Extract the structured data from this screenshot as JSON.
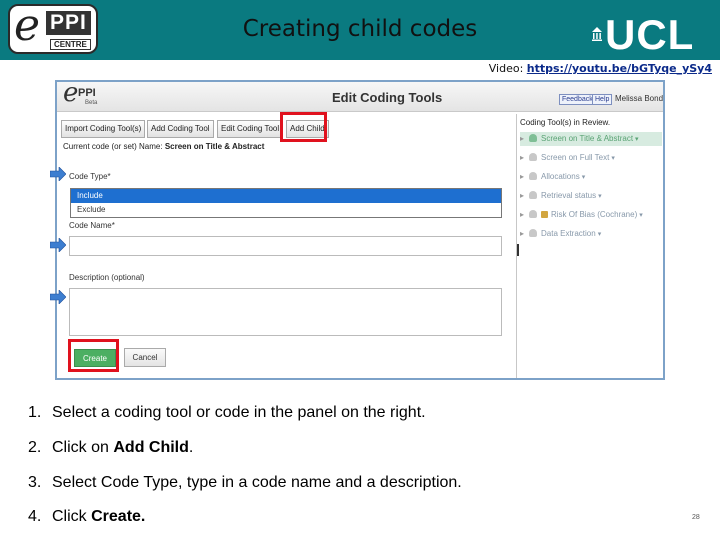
{
  "slide": {
    "title": "Creating child codes",
    "video_prefix": "Video: ",
    "video_link": "https://youtu.be/bGTyqe_ySy4",
    "page_number": "28"
  },
  "logos": {
    "eppi_letter": "e",
    "eppi_ppi": "PPI",
    "eppi_centre": "CENTRE",
    "ucl": "UCL"
  },
  "app": {
    "logo_letter": "e",
    "logo_text": "PPI",
    "logo_sub": "Beta",
    "title": "Edit Coding Tools",
    "feedback": "Feedback",
    "help": "Help",
    "user": "Melissa Bond",
    "tools": [
      "Import Coding Tool(s)",
      "Add Coding Tool",
      "Edit Coding Tool",
      "Add Child"
    ],
    "current_label": "Current code (or set) Name: ",
    "current_value": "Screen on Title & Abstract",
    "code_type_label": "Code Type*",
    "code_type_options": [
      "Include",
      "Exclude"
    ],
    "code_name_label": "Code Name*",
    "code_name_value": "",
    "description_label": "Description (optional)",
    "description_value": "",
    "create": "Create",
    "cancel": "Cancel",
    "tree_title": "Coding Tool(s) in Review.",
    "tree": [
      {
        "label": "Screen on Title & Abstract",
        "active": true
      },
      {
        "label": "Screen on Full Text",
        "active": false
      },
      {
        "label": "Allocations",
        "active": false
      },
      {
        "label": "Retrieval status",
        "active": false
      },
      {
        "label": "Risk Of Bias (Cochrane)",
        "active": false
      },
      {
        "label": "Data Extraction",
        "active": false
      }
    ]
  },
  "steps": [
    {
      "num": "1.",
      "pre": "Select a coding tool or code in the panel on the right.",
      "bold": "",
      "post": ""
    },
    {
      "num": "2.",
      "pre": "Click on ",
      "bold": "Add Child",
      "post": "."
    },
    {
      "num": "3.",
      "pre": "Select Code Type, type in a code name and a description.",
      "bold": "",
      "post": ""
    },
    {
      "num": "4.",
      "pre": "Click ",
      "bold": "Create.",
      "post": ""
    }
  ],
  "colors": {
    "header": "#0a7a80",
    "highlight": "#e0121e",
    "create_button": "#4caf62",
    "selected_option": "#1e6fd0"
  }
}
